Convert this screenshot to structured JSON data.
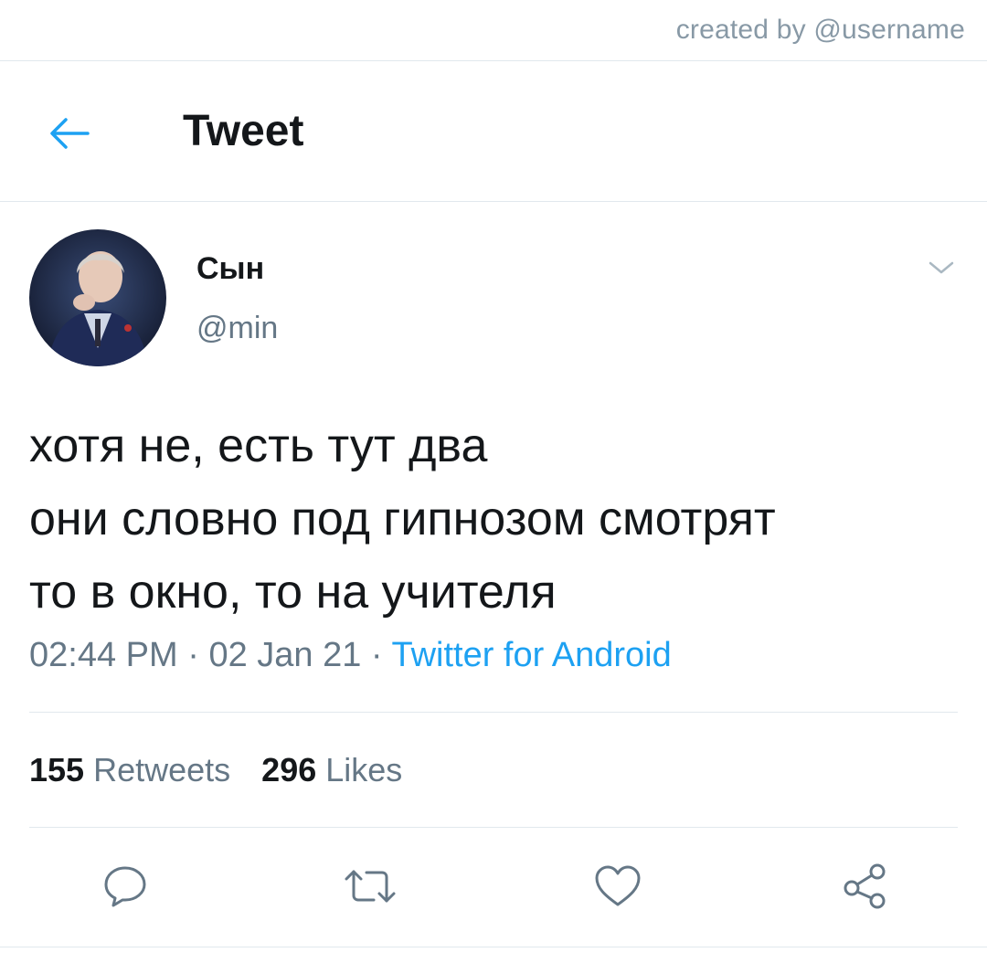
{
  "credit": "created by @username",
  "header": {
    "title": "Tweet",
    "back_icon": "arrow-left-icon",
    "accent": "#1da1f2"
  },
  "author": {
    "display_name": "Сын",
    "handle": "@min"
  },
  "tweet": {
    "lines": [
      "хотя не, есть тут два",
      "они словно под гипнозом смотрят",
      "то в окно, то на учителя"
    ],
    "time": "02:44 PM",
    "separator": "·",
    "date": "02 Jan 21",
    "source": "Twitter for Android"
  },
  "stats": {
    "retweets_count": "155",
    "retweets_label": "Retweets",
    "likes_count": "296",
    "likes_label": "Likes"
  },
  "actions": {
    "reply_icon": "reply-icon",
    "retweet_icon": "retweet-icon",
    "like_icon": "heart-icon",
    "share_icon": "share-icon"
  },
  "colors": {
    "text": "#14171a",
    "secondary": "#657786",
    "link": "#1da1f2",
    "divider": "#e1e8ed",
    "icon": "#657786"
  }
}
